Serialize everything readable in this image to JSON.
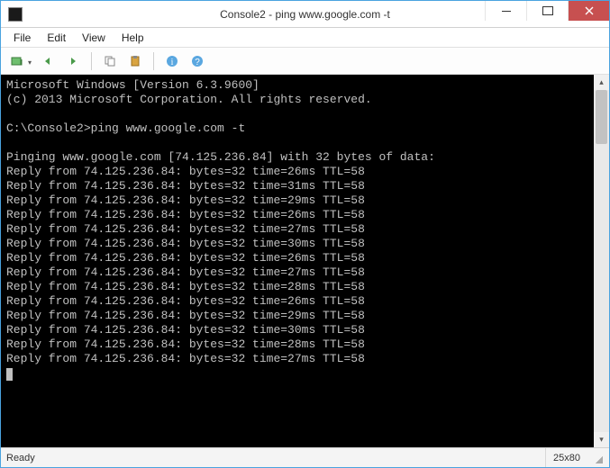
{
  "window": {
    "title": "Console2 - ping  www.google.com -t"
  },
  "menu": {
    "file": "File",
    "edit": "Edit",
    "view": "View",
    "help": "Help"
  },
  "console": {
    "header1": "Microsoft Windows [Version 6.3.9600]",
    "header2": "(c) 2013 Microsoft Corporation. All rights reserved.",
    "prompt": "C:\\Console2>ping www.google.com -t",
    "pinging": "Pinging www.google.com [74.125.236.84] with 32 bytes of data:",
    "replies": [
      "Reply from 74.125.236.84: bytes=32 time=26ms TTL=58",
      "Reply from 74.125.236.84: bytes=32 time=31ms TTL=58",
      "Reply from 74.125.236.84: bytes=32 time=29ms TTL=58",
      "Reply from 74.125.236.84: bytes=32 time=26ms TTL=58",
      "Reply from 74.125.236.84: bytes=32 time=27ms TTL=58",
      "Reply from 74.125.236.84: bytes=32 time=30ms TTL=58",
      "Reply from 74.125.236.84: bytes=32 time=26ms TTL=58",
      "Reply from 74.125.236.84: bytes=32 time=27ms TTL=58",
      "Reply from 74.125.236.84: bytes=32 time=28ms TTL=58",
      "Reply from 74.125.236.84: bytes=32 time=26ms TTL=58",
      "Reply from 74.125.236.84: bytes=32 time=29ms TTL=58",
      "Reply from 74.125.236.84: bytes=32 time=30ms TTL=58",
      "Reply from 74.125.236.84: bytes=32 time=28ms TTL=58",
      "Reply from 74.125.236.84: bytes=32 time=27ms TTL=58"
    ]
  },
  "status": {
    "ready": "Ready",
    "dims": "25x80"
  }
}
